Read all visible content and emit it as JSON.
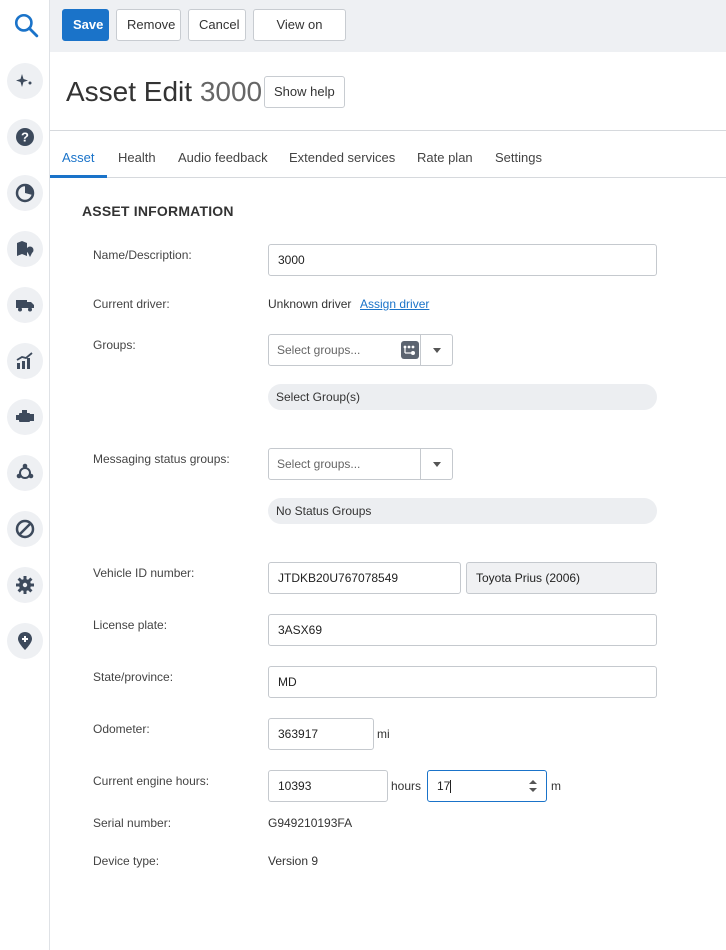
{
  "toolbar": {
    "save_label": "Save",
    "remove_label": "Remove",
    "cancel_label": "Cancel",
    "view_map_label": "View on map"
  },
  "header": {
    "title": "Asset Edit",
    "asset_id": "3000",
    "help_label": "Show help"
  },
  "tabs": [
    "Asset",
    "Health",
    "Audio feedback",
    "Extended services",
    "Rate plan",
    "Settings"
  ],
  "active_tab": "Asset",
  "section": {
    "title": "ASSET INFORMATION"
  },
  "form": {
    "name": {
      "label": "Name/Description:",
      "value": "3000"
    },
    "driver": {
      "label": "Current driver:",
      "value": "Unknown driver",
      "link": "Assign driver"
    },
    "groups": {
      "label": "Groups:",
      "placeholder": "Select groups...",
      "pill": "Select Group(s)"
    },
    "status_groups": {
      "label": "Messaging status groups:",
      "placeholder": "Select groups...",
      "pill": "No Status Groups"
    },
    "vin": {
      "label": "Vehicle ID number:",
      "value": "JTDKB20U767078549",
      "decoded": "Toyota Prius (2006)"
    },
    "plate": {
      "label": "License plate:",
      "value": "3ASX69"
    },
    "state": {
      "label": "State/province:",
      "value": "MD"
    },
    "odometer": {
      "label": "Odometer:",
      "value": "363917",
      "unit": "mi"
    },
    "engine_hours": {
      "label": "Current engine hours:",
      "hours": "10393",
      "hours_unit": "hours",
      "minutes": "17",
      "minutes_unit": "m"
    },
    "serial": {
      "label": "Serial number:",
      "value": "G949210193FA"
    },
    "device": {
      "label": "Device type:",
      "value": "Version 9"
    }
  },
  "colors": {
    "accent": "#1a73c9"
  },
  "sidebar_icons": [
    "search-icon",
    "sparkle-icon",
    "help-icon",
    "pie-chart-icon",
    "map-pin-icon",
    "truck-icon",
    "trend-chart-icon",
    "engine-icon",
    "network-icon",
    "no-entry-icon",
    "gear-icon",
    "location-plus-icon"
  ]
}
